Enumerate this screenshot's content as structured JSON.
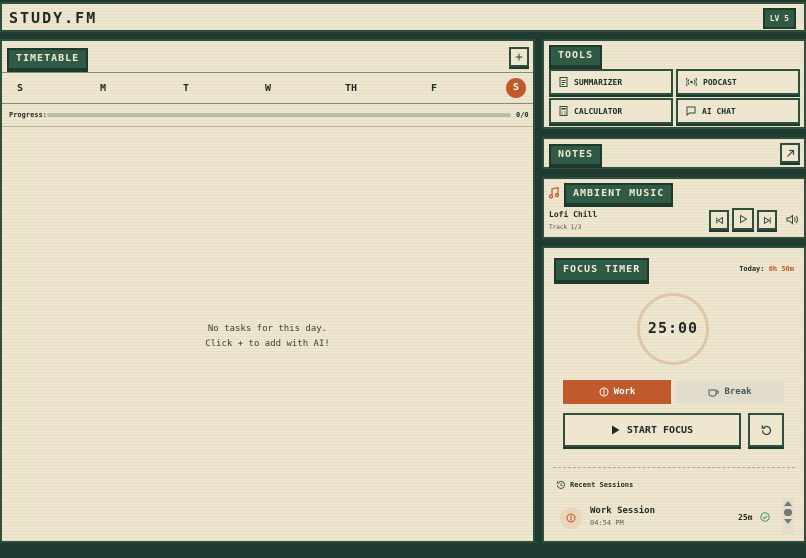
{
  "header": {
    "title": "STUDY.FM",
    "level": "LV 5"
  },
  "timetable": {
    "title": "TIMETABLE",
    "add_label": "+",
    "days": [
      "S",
      "M",
      "T",
      "W",
      "TH",
      "F",
      "S"
    ],
    "active_day_index": 6,
    "progress_label": "Progress:",
    "progress_value": "0/0",
    "progress_fraction": 0,
    "empty_line1": "No tasks for this day.",
    "empty_line2": "Click + to add with AI!"
  },
  "tools": {
    "title": "TOOLS",
    "items": [
      {
        "label": "SUMMARIZER",
        "icon": "document-icon"
      },
      {
        "label": "PODCAST",
        "icon": "broadcast-icon"
      },
      {
        "label": "CALCULATOR",
        "icon": "calculator-icon"
      },
      {
        "label": "AI CHAT",
        "icon": "chat-icon"
      }
    ]
  },
  "notes": {
    "title": "NOTES"
  },
  "music": {
    "title": "AMBIENT MUSIC",
    "track_name": "Lofi Chill",
    "track_count": "Track 1/3"
  },
  "focus": {
    "title": "FOCUS TIMER",
    "today_label": "Today:",
    "today_value": "0h 50m",
    "timer": "25:00",
    "mode_work": "Work",
    "mode_break": "Break",
    "start_label": "START FOCUS",
    "recent_title": "Recent Sessions",
    "sessions": [
      {
        "name": "Work Session",
        "time": "04:54 PM",
        "duration": "25m"
      }
    ]
  },
  "colors": {
    "accent": "#c0592b",
    "panel": "#efe6cf",
    "dark_green": "#2f5a46"
  }
}
